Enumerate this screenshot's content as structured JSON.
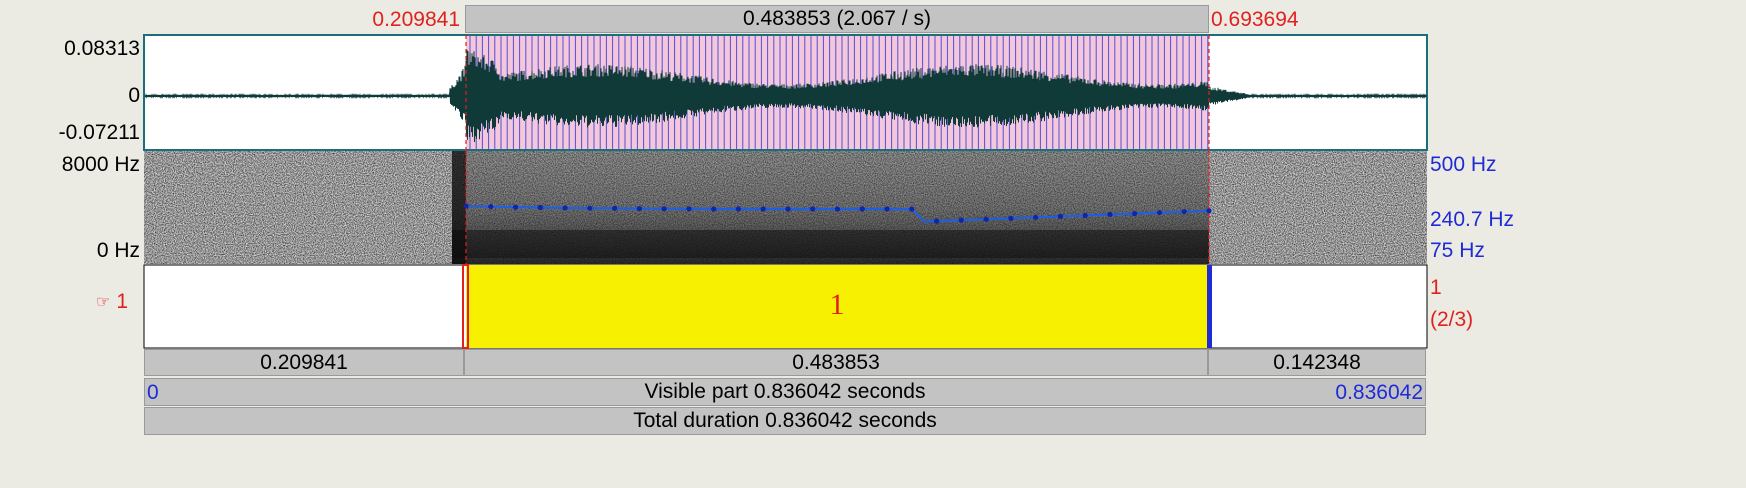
{
  "selection": {
    "start_label": "0.209841",
    "end_label": "0.693694",
    "duration_label": "0.483853 (2.067 / s)"
  },
  "waveform": {
    "max_label": "0.08313",
    "zero_label": "0",
    "min_label": "-0.07211"
  },
  "spectrogram": {
    "freq_max_label": "8000 Hz",
    "freq_min_label": "0 Hz",
    "pitch_max_label": "500 Hz",
    "pitch_current_label": "240.7 Hz",
    "pitch_min_label": "75 Hz",
    "colors": {
      "pitch": "#1f5fe0"
    }
  },
  "tier": {
    "pointer_icon": "pointing-hand-icon",
    "tier_label": "1",
    "interval_text": "1",
    "right_number": "1",
    "right_count": "(2/3)",
    "colors": {
      "interval": "#f7f000",
      "boundary_left": "#e0211f",
      "boundary_right": "#1f2bd6"
    }
  },
  "duration_bar": {
    "left_segment": "0.209841",
    "middle_segment": "0.483853",
    "right_segment": "0.142348"
  },
  "visible_bar": {
    "start": "0",
    "text": "Visible part 0.836042 seconds",
    "end": "0.836042"
  },
  "total_bar": {
    "text": "Total duration 0.836042 seconds"
  }
}
